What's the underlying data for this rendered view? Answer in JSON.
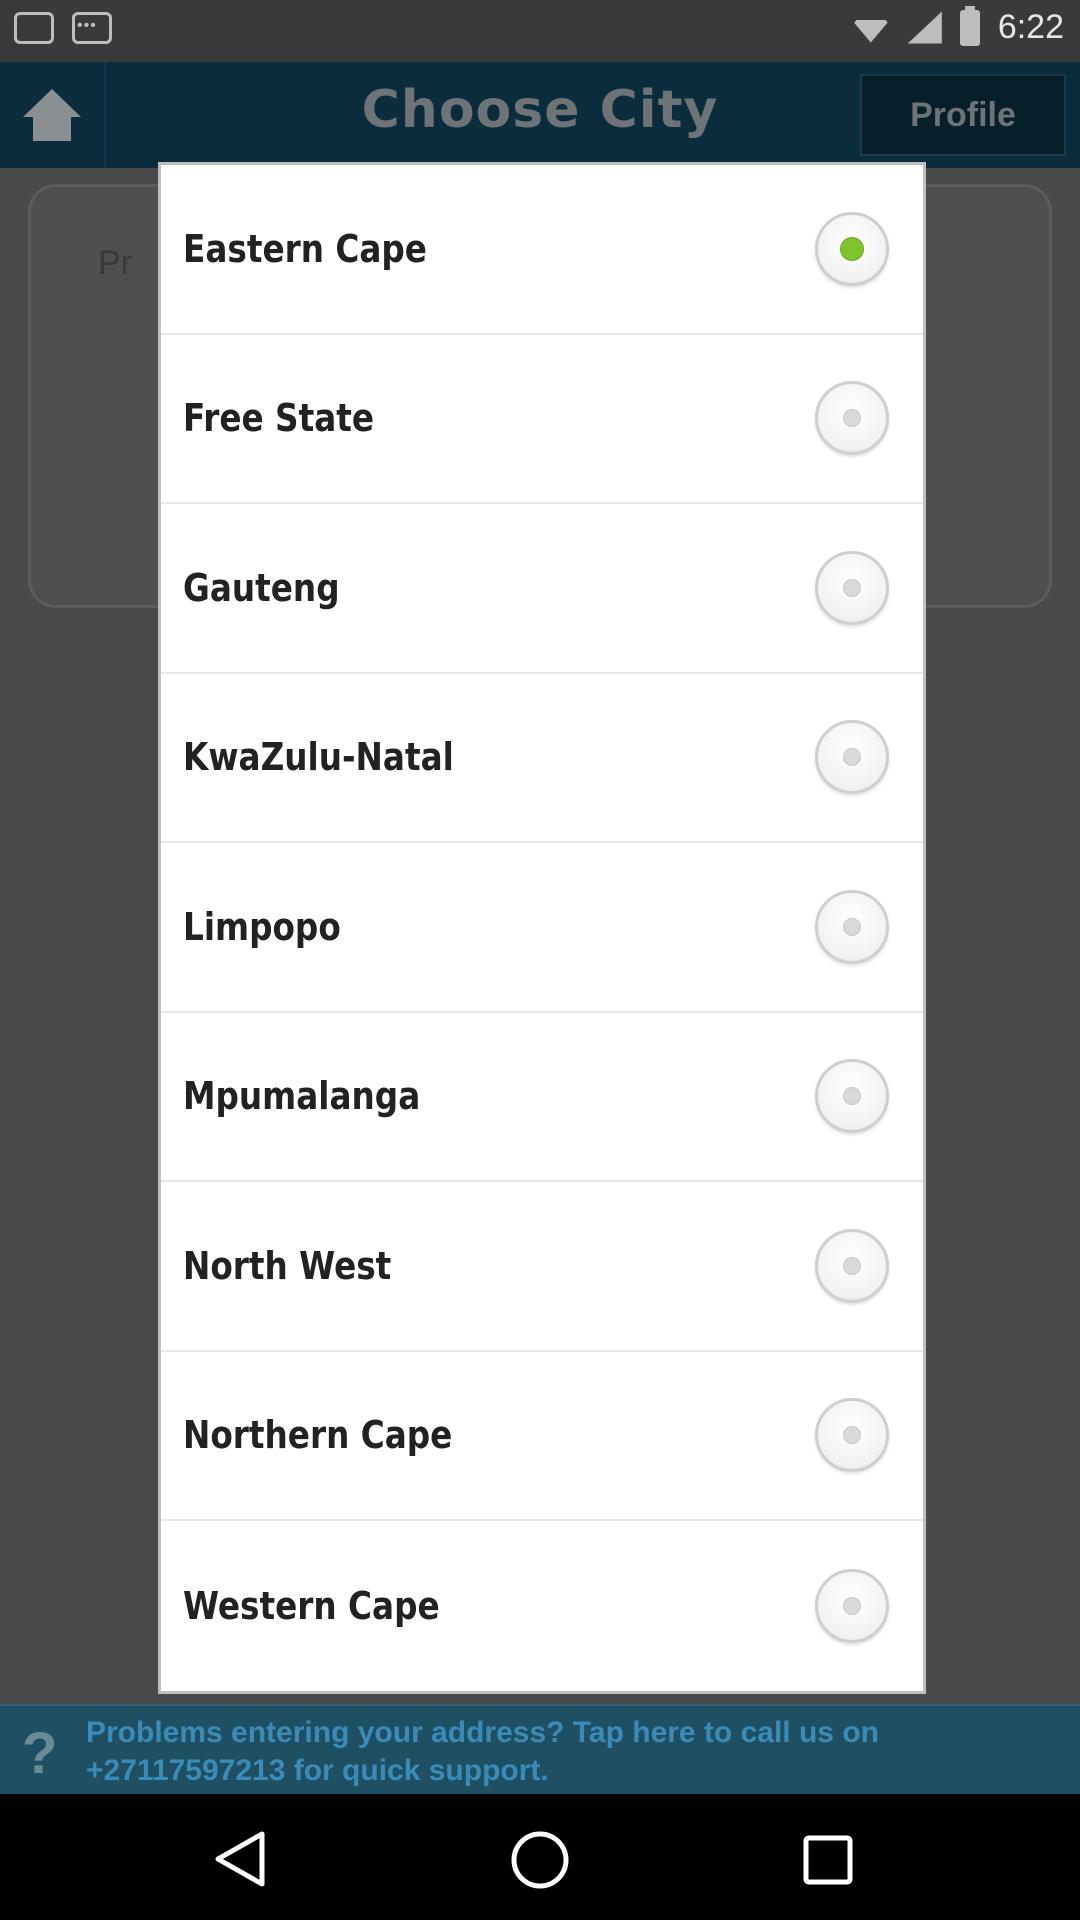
{
  "status_bar": {
    "time": "6:22",
    "icons": [
      "notification-box-icon",
      "more-dots-icon",
      "wifi-icon",
      "signal-icon",
      "battery-icon"
    ]
  },
  "app_bar": {
    "title": "Choose City",
    "profile_label": "Profile",
    "home_icon": "home-icon"
  },
  "background_card": {
    "visible_text_fragment": "Pr"
  },
  "dialog": {
    "options": [
      {
        "label": "Eastern Cape",
        "selected": true
      },
      {
        "label": "Free State",
        "selected": false
      },
      {
        "label": "Gauteng",
        "selected": false
      },
      {
        "label": "KwaZulu-Natal",
        "selected": false
      },
      {
        "label": "Limpopo",
        "selected": false
      },
      {
        "label": "Mpumalanga",
        "selected": false
      },
      {
        "label": "North West",
        "selected": false
      },
      {
        "label": "Northern Cape",
        "selected": false
      },
      {
        "label": "Western Cape",
        "selected": false
      }
    ]
  },
  "support_bar": {
    "text": "Problems entering your address? Tap here to call us on +27117597213 for quick support.",
    "icon": "question-icon"
  },
  "nav_bar": {
    "icons": [
      "back-icon",
      "home-circle-icon",
      "recents-icon"
    ]
  },
  "colors": {
    "selected_radio": "#7ec42c",
    "app_bar_bg": "#0a2c3d",
    "support_text": "#3b8bb8"
  }
}
